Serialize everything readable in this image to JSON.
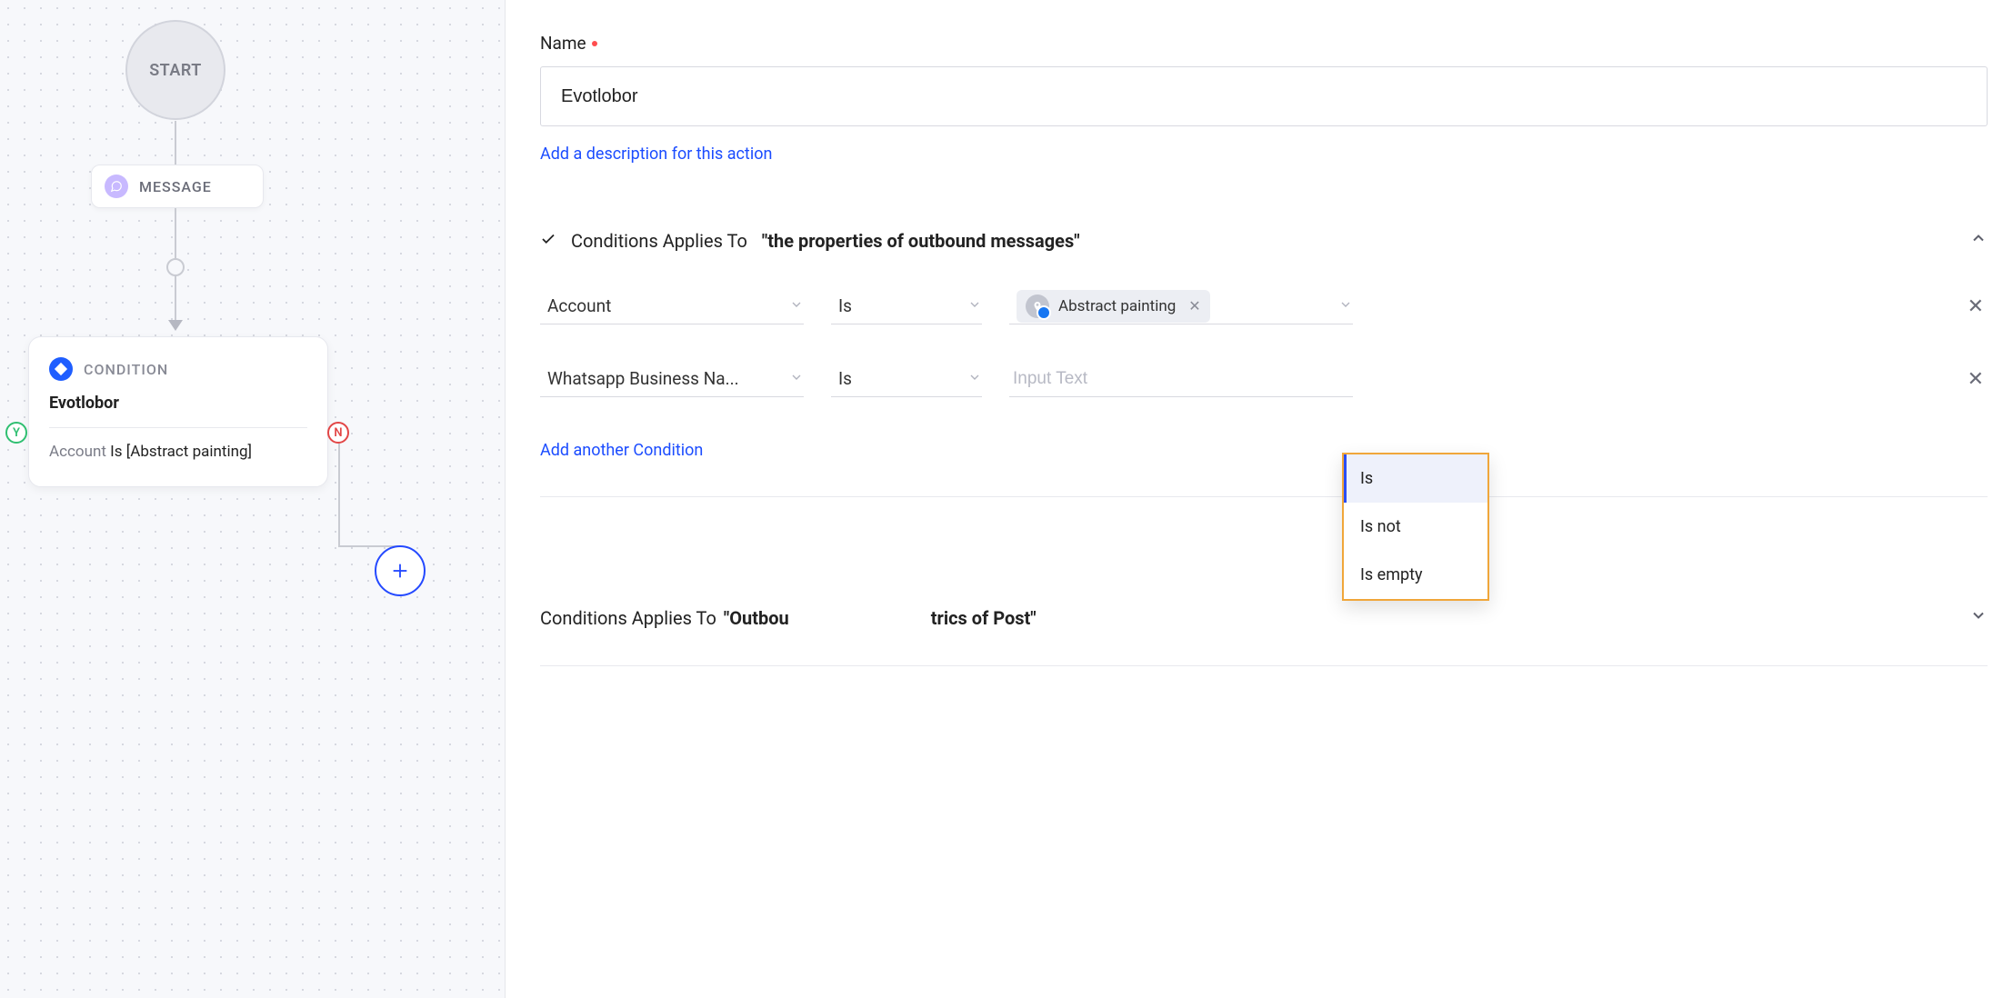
{
  "canvas": {
    "start_label": "START",
    "message_label": "MESSAGE",
    "condition": {
      "type_label": "CONDITION",
      "name": "Evotlobor",
      "rule_field": "Account",
      "rule_operator": "Is",
      "rule_value": "[Abstract painting]"
    },
    "y_label": "Y",
    "n_label": "N"
  },
  "panel": {
    "name_label": "Name",
    "name_value": "Evotlobor",
    "add_description_link": "Add a description for this action",
    "section1": {
      "prefix": "Conditions Applies To ",
      "target_quoted": "\"the properties of outbound messages\"",
      "rows": [
        {
          "field": "Account",
          "operator": "Is",
          "value_chip": "Abstract painting"
        },
        {
          "field": "Whatsapp Business Na...",
          "operator": "Is",
          "placeholder": "Input Text"
        }
      ],
      "add_link": "Add another Condition"
    },
    "operator_menu": {
      "options": [
        "Is",
        "Is not",
        "Is empty"
      ],
      "active": "Is"
    },
    "section2": {
      "prefix": "Conditions Applies To ",
      "target_quoted_a": "\"Outbou",
      "target_quoted_b": "trics of Post\""
    }
  }
}
